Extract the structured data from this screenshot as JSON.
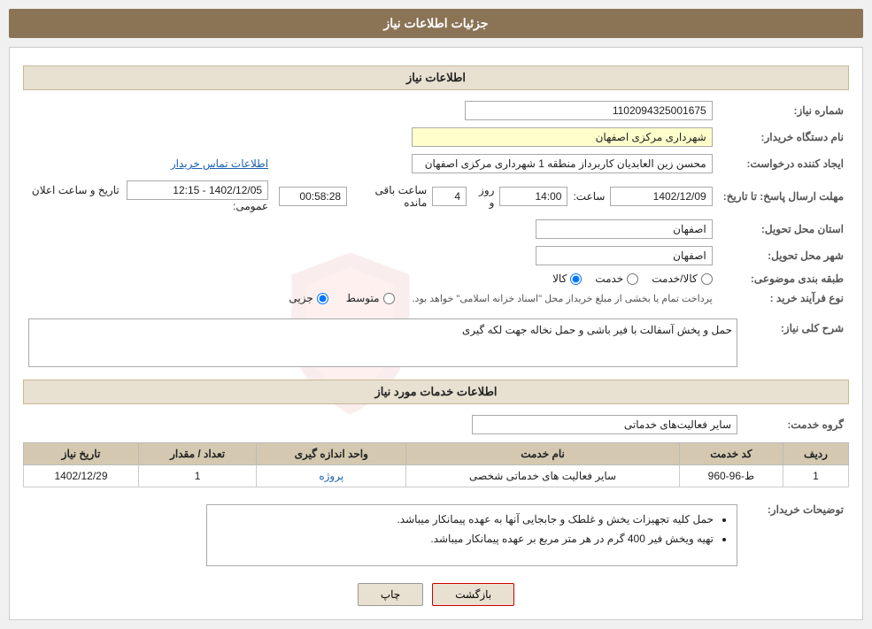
{
  "header": {
    "title": "جزئیات اطلاعات نیاز"
  },
  "section1": {
    "title": "اطلاعات نیاز"
  },
  "fields": {
    "need_number_label": "شماره نیاز:",
    "need_number_value": "1102094325001675",
    "org_name_label": "نام دستگاه خریدار:",
    "org_name_value": "شهرداری مرکزی اصفهان",
    "creator_label": "ایجاد کننده درخواست:",
    "creator_value": "محسن زین العابدیان کاربرداز منطقه 1 شهرداری مرکزی اصفهان",
    "creator_link": "اطلاعات تماس خریدار",
    "send_deadline_label": "مهلت ارسال پاسخ: تا تاریخ:",
    "date_value": "1402/12/09",
    "time_label": "ساعت:",
    "time_value": "14:00",
    "days_label": "روز و",
    "days_value": "4",
    "remaining_label": "ساعت باقی مانده",
    "remaining_value": "00:58:28",
    "announce_label": "تاریخ و ساعت اعلان عمومی:",
    "announce_value": "1402/12/05 - 12:15",
    "province_label": "استان محل تحویل:",
    "province_value": "اصفهان",
    "city_label": "شهر محل تحویل:",
    "city_value": "اصفهان",
    "category_label": "طبقه بندی موضوعی:",
    "category_radio1": "کالا",
    "category_radio2": "خدمت",
    "category_radio3": "کالا/خدمت",
    "process_label": "نوع فرآیند خرید :",
    "process_radio1": "جزیی",
    "process_radio2": "متوسط",
    "process_desc": "پرداخت تمام یا بخشی از مبلغ خریداز محل \"اسناد خزانه اسلامی\" خواهد بود.",
    "need_desc_label": "شرح کلی نیاز:",
    "need_desc_value": "حمل و پخش آسفالت با فیر باشی و حمل نخاله جهت لکه گیری"
  },
  "section2": {
    "title": "اطلاعات خدمات مورد نیاز"
  },
  "service_group_label": "گروه خدمت:",
  "service_group_value": "سایر فعالیت‌های خدماتی",
  "table": {
    "headers": [
      "ردیف",
      "کد خدمت",
      "نام خدمت",
      "واحد اندازه گیری",
      "تعداد / مقدار",
      "تاریخ نیاز"
    ],
    "rows": [
      {
        "row_num": "1",
        "code": "ط-96-960",
        "name": "سایر فعالیت های خدماتی شخصی",
        "unit": "پروژه",
        "count": "1",
        "date": "1402/12/29"
      }
    ]
  },
  "buyer_notes_label": "توضیحات خریدار:",
  "buyer_notes": [
    "حمل کلیه تجهیزات یخش و غلطک و جابجایی آنها به عهده پیمانکار میباشد.",
    "تهیه ویخش فیر 400 گرم در هر متر مربع بر عهده پیمانکار میباشد."
  ],
  "buttons": {
    "print": "چاپ",
    "back": "بازگشت"
  }
}
